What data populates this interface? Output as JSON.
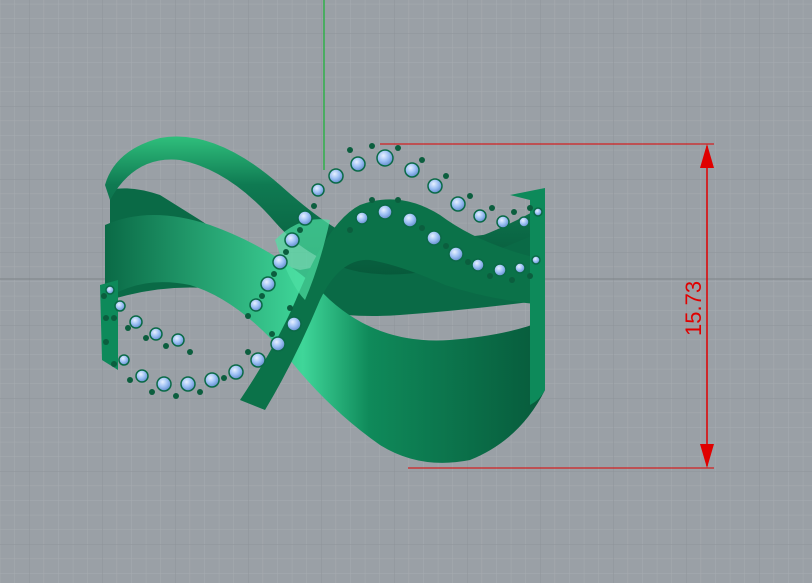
{
  "viewport": {
    "background": "#9aa0a6",
    "grid_color": "#a9aeb3",
    "axis_y_color": "#2fb04a",
    "axis_x_color": "#8a8f94"
  },
  "model": {
    "metal_color": "#0f7a52",
    "metal_highlight": "#3dd494",
    "stone_color": "#8fb6f2"
  },
  "dimension": {
    "value": "15.73",
    "color": "#e00000"
  }
}
